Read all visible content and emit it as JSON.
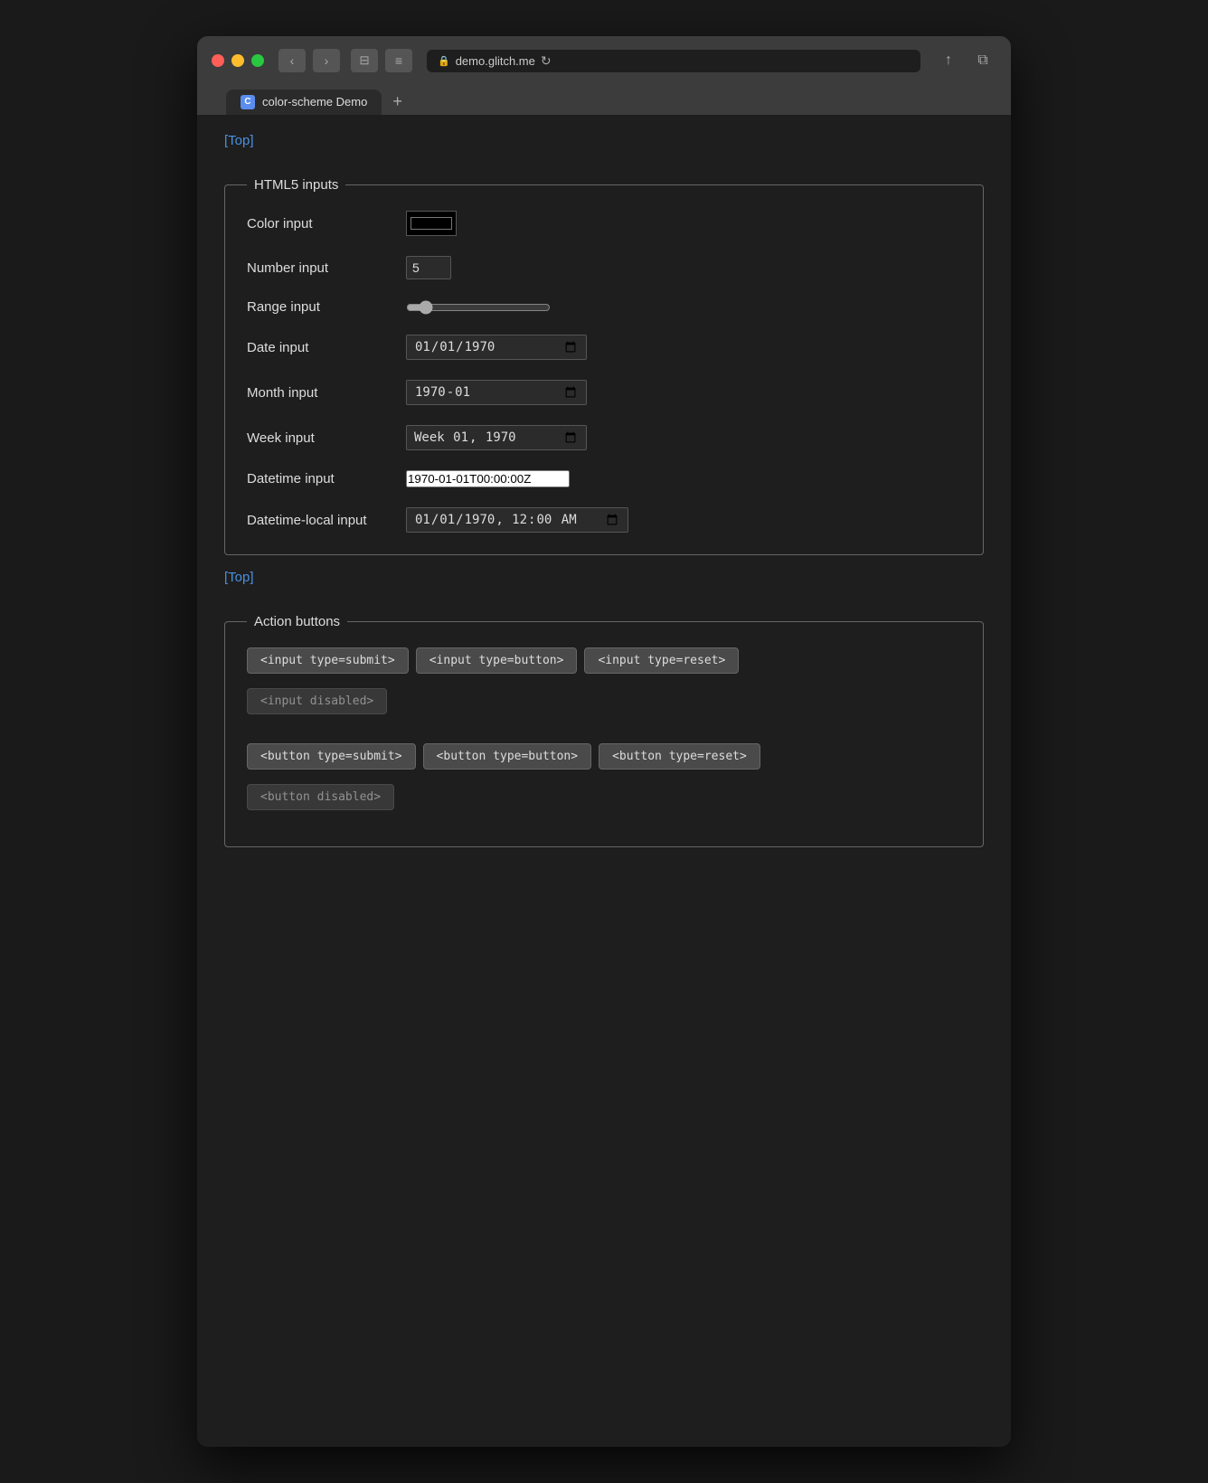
{
  "browser": {
    "url": "demo.glitch.me",
    "tab_label": "color-scheme Demo",
    "tab_icon": "C",
    "new_tab_label": "+"
  },
  "nav": {
    "back": "‹",
    "forward": "›",
    "sidebar": "⊟",
    "menu": "≡",
    "share": "↑",
    "windows": "⧉",
    "reload": "↻"
  },
  "top_link": "[Top]",
  "html5_section": {
    "legend": "HTML5 inputs",
    "color_label": "Color input",
    "color_value": "#000000",
    "number_label": "Number input",
    "number_value": "5",
    "range_label": "Range input",
    "range_value": "10",
    "date_label": "Date input",
    "date_value": "1970-01-01",
    "month_label": "Month input",
    "month_value": "1970-01",
    "week_label": "Week input",
    "week_value": "1970-W01",
    "datetime_label": "Datetime input",
    "datetime_value": "1970-01-01T00:00:00Z",
    "datetime_local_label": "Datetime-local input",
    "datetime_local_value": "1970-01-01T00:00"
  },
  "bottom_link": "[Top]",
  "action_section": {
    "legend": "Action buttons",
    "buttons_row1": [
      "<input type=submit>",
      "<input type=button>",
      "<input type=reset>"
    ],
    "buttons_row2": [
      "<input disabled>"
    ],
    "buttons_row3": [
      "<button type=submit>",
      "<button type=button>",
      "<button type=reset>"
    ],
    "buttons_row4": [
      "<button disabled>"
    ]
  }
}
